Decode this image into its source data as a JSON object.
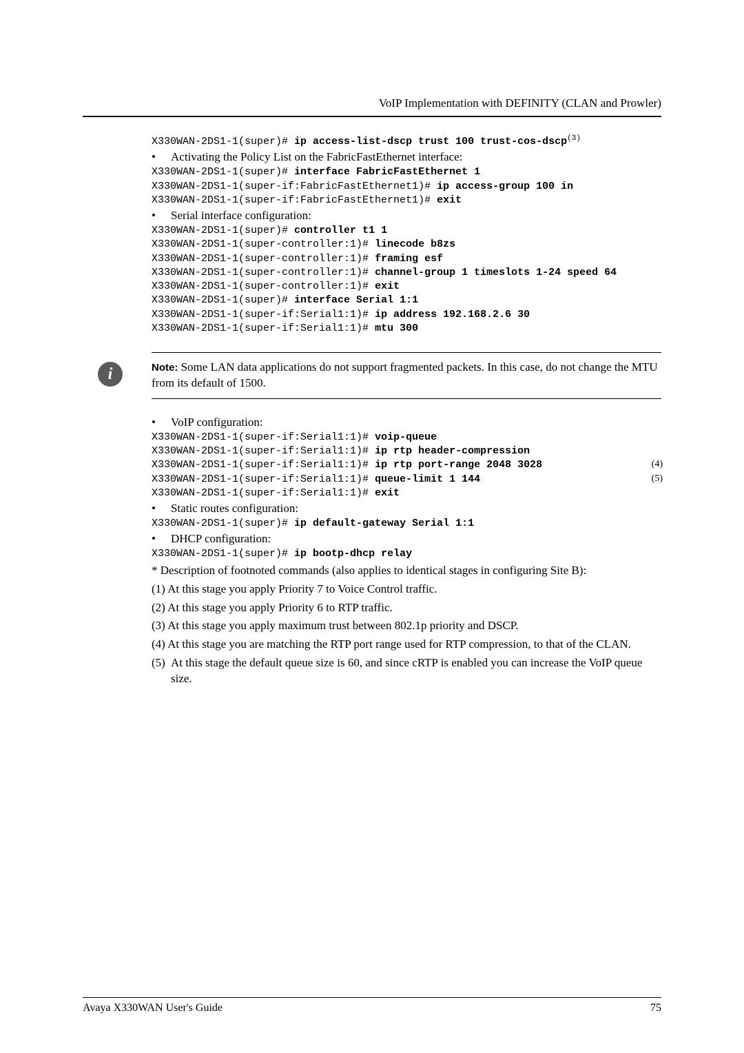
{
  "header": {
    "title": "VoIP Implementation with DEFINITY (CLAN and Prowler)"
  },
  "block1": {
    "l1a": "X330WAN-2DS1-1(super)# ",
    "l1b": "ip access-list-dscp trust 100 trust-cos-dscp",
    "l1sup": "(3)",
    "bullet1": "Activating the Policy List on the FabricFastEthernet interface:",
    "l2a": "X330WAN-2DS1-1(super)# ",
    "l2b": "interface FabricFastEthernet 1",
    "l3a": "X330WAN-2DS1-1(super-if:FabricFastEthernet1)# ",
    "l3b": "ip access-group 100 in",
    "l4a": "X330WAN-2DS1-1(super-if:FabricFastEthernet1)# ",
    "l4b": "exit",
    "bullet2": "Serial interface configuration:",
    "l5a": "X330WAN-2DS1-1(super)# ",
    "l5b": "controller t1 1",
    "l6a": "X330WAN-2DS1-1(super-controller:1)# ",
    "l6b": "linecode b8zs",
    "l7a": "X330WAN-2DS1-1(super-controller:1)# ",
    "l7b": "framing esf",
    "l8a": "X330WAN-2DS1-1(super-controller:1)# ",
    "l8b": "channel-group 1 timeslots 1-24 speed 64",
    "l9a": "X330WAN-2DS1-1(super-controller:1)# ",
    "l9b": "exit",
    "l10a": "X330WAN-2DS1-1(super)# ",
    "l10b": "interface Serial 1:1",
    "l11a": "X330WAN-2DS1-1(super-if:Serial1:1)# ",
    "l11b": "ip address 192.168.2.6 30",
    "l12a": "X330WAN-2DS1-1(super-if:Serial1:1)# ",
    "l12b": "mtu 300"
  },
  "note": {
    "label": "Note:",
    "text": " Some LAN data applications do not support fragmented packets. In this case, do not change the MTU from its default of 1500."
  },
  "block2": {
    "bullet1": "VoIP configuration:",
    "l1a": "X330WAN-2DS1-1(super-if:Serial1:1)# ",
    "l1b": "voip-queue",
    "l2a": "X330WAN-2DS1-1(super-if:Serial1:1)# ",
    "l2b": "ip rtp header-compression",
    "l3a": "X330WAN-2DS1-1(super-if:Serial1:1)# ",
    "l3b": "ip rtp port-range 2048 3028",
    "anno3": "(4)",
    "l4a": "X330WAN-2DS1-1(super-if:Serial1:1)# ",
    "l4b": "queue-limit 1 144",
    "anno4": "(5)",
    "l5a": "X330WAN-2DS1-1(super-if:Serial1:1)# ",
    "l5b": "exit",
    "bullet2": "Static routes configuration:",
    "l6a": "X330WAN-2DS1-1(super)# ",
    "l6b": "ip default-gateway Serial 1:1",
    "bullet3": "DHCP configuration:",
    "l7a": "X330WAN-2DS1-1(super)# ",
    "l7b": "ip bootp-dhcp relay"
  },
  "desc": {
    "intro": "* Description of footnoted commands (also applies to identical stages in configuring Site B):",
    "f1": "(1) At this stage you apply Priority 7 to Voice Control traffic.",
    "f2": "(2) At this stage you apply Priority 6 to RTP traffic.",
    "f3": "(3) At this stage you apply maximum trust between 802.1p priority and DSCP.",
    "f4": "(4) At this stage you are matching the RTP port range used for RTP compression, to that of the CLAN.",
    "f5num": "(5)",
    "f5": "At this stage the default queue size is 60, and since cRTP is enabled you can increase the VoIP queue size."
  },
  "footer": {
    "left": "Avaya X330WAN User's Guide",
    "right": "75"
  }
}
